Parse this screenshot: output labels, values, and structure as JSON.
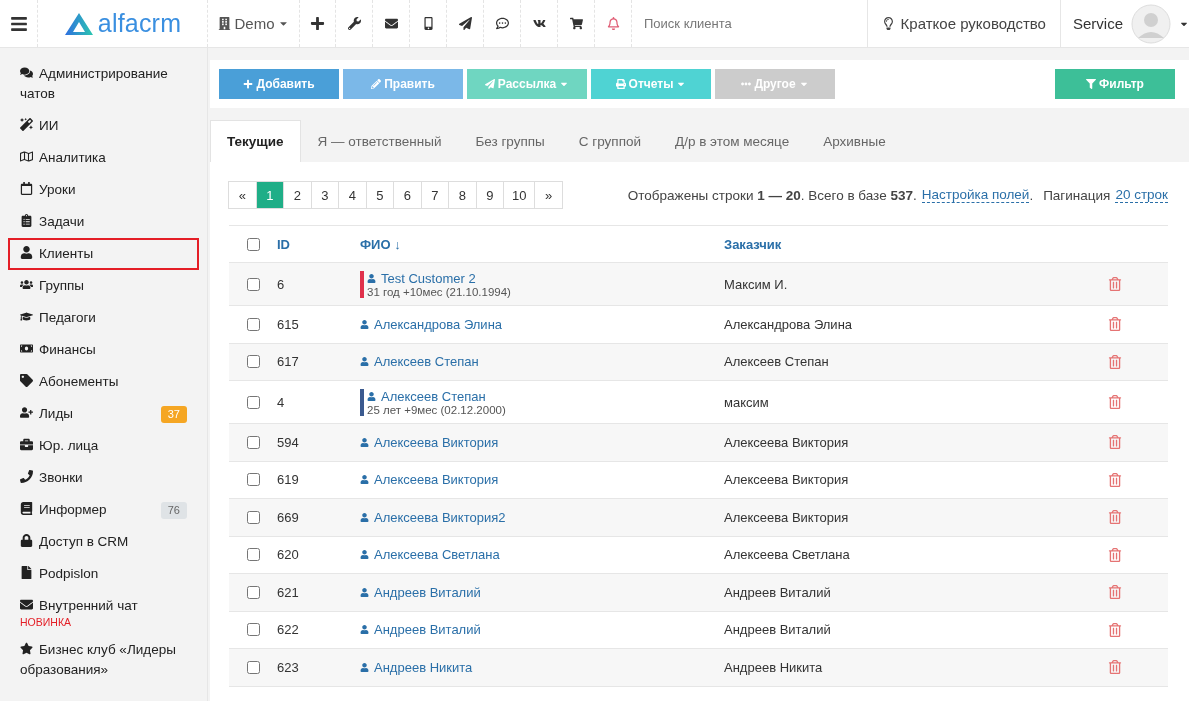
{
  "header": {
    "logo": "alfacrm",
    "branch": "Demo",
    "search": {
      "placeholder": "Поиск клиента"
    },
    "guide": "Краткое руководство",
    "user": "Service"
  },
  "sidebar": {
    "items": [
      {
        "label": "Администрирование чатов",
        "selected": false
      },
      {
        "label": "ИИ",
        "selected": false
      },
      {
        "label": "Аналитика",
        "selected": false
      },
      {
        "label": "Уроки",
        "selected": false
      },
      {
        "label": "Задачи",
        "selected": false
      },
      {
        "label": "Клиенты",
        "selected": true
      },
      {
        "label": "Группы",
        "selected": false
      },
      {
        "label": "Педагоги",
        "selected": false
      },
      {
        "label": "Финансы",
        "selected": false
      },
      {
        "label": "Абонементы",
        "selected": false
      },
      {
        "label": "Лиды",
        "selected": false,
        "badge": "37",
        "color": "#f5a623"
      },
      {
        "label": "Юр. лица",
        "selected": false
      },
      {
        "label": "Звонки",
        "selected": false
      },
      {
        "label": "Информер",
        "selected": false,
        "badge": "76",
        "color": "#dfe3e6"
      },
      {
        "label": "Доступ в CRM",
        "selected": false
      },
      {
        "label": "Podpislon",
        "selected": false
      },
      {
        "label": "Внутренний чат",
        "selected": false,
        "note": "НОВИНКА"
      },
      {
        "label": "Бизнес клуб «Лидеры образования»",
        "selected": false
      }
    ]
  },
  "toolbar": {
    "buttons": [
      {
        "label": "Добавить",
        "color": "#4a9fd8",
        "caret": false
      },
      {
        "label": "Править",
        "color": "#7bb8e8",
        "caret": false
      },
      {
        "label": "Рассылка",
        "color": "#6fd6c1",
        "caret": true
      },
      {
        "label": "Отчеты",
        "color": "#4fd3d3",
        "caret": true
      },
      {
        "label": "Другое",
        "color": "#cccccc",
        "caret": true
      }
    ],
    "filter": {
      "label": "Фильтр",
      "color": "#3dbf98"
    }
  },
  "tabs": [
    {
      "label": "Текущие",
      "selected": true
    },
    {
      "label": "Я — ответственный",
      "selected": false
    },
    {
      "label": "Без группы",
      "selected": false
    },
    {
      "label": "С группой",
      "selected": false
    },
    {
      "label": "Д/р в этом месяце",
      "selected": false
    },
    {
      "label": "Архивные",
      "selected": false
    }
  ],
  "pagination": {
    "pages": [
      {
        "label": "«",
        "selected": false
      },
      {
        "label": "1",
        "selected": true
      },
      {
        "label": "2",
        "selected": false
      },
      {
        "label": "3",
        "selected": false
      },
      {
        "label": "4",
        "selected": false
      },
      {
        "label": "5",
        "selected": false
      },
      {
        "label": "6",
        "selected": false
      },
      {
        "label": "7",
        "selected": false
      },
      {
        "label": "8",
        "selected": false
      },
      {
        "label": "9",
        "selected": false
      },
      {
        "label": "10",
        "selected": false
      },
      {
        "label": "»",
        "selected": false
      }
    ],
    "summary": "Отображены строки **1 — 20**. Всего в базе **537**.",
    "fields_link": "Настройка полей",
    "separator": ".",
    "per_page_label": "Пагинация",
    "per_page_link": "20 строк"
  },
  "table": {
    "select_all": {
      "checked": false
    },
    "columns": [
      "ID",
      "ФИО ↓",
      "Заказчик"
    ],
    "rows": [
      {
        "id": "6",
        "name": "Test Customer 2",
        "age": "31 год +10мес (21.10.1994)",
        "color": "#e0314b",
        "customer": "Максим И.",
        "checked": false
      },
      {
        "id": "615",
        "name": "Александрова Элина",
        "customer": "Александрова Элина",
        "checked": false
      },
      {
        "id": "617",
        "name": "Алексеев Степан",
        "customer": "Алексеев Степан",
        "checked": false
      },
      {
        "id": "4",
        "name": "Алексеев Степан",
        "age": "25 лет +9мес (02.12.2000)",
        "color": "#3b5a8f",
        "customer": "максим",
        "checked": false
      },
      {
        "id": "594",
        "name": "Алексеева Виктория",
        "customer": "Алексеева Виктория",
        "checked": false
      },
      {
        "id": "619",
        "name": "Алексеева Виктория",
        "customer": "Алексеева Виктория",
        "checked": false
      },
      {
        "id": "669",
        "name": "Алексеева Виктория2",
        "customer": "Алексеева Виктория",
        "checked": false
      },
      {
        "id": "620",
        "name": "Алексеева Светлана",
        "customer": "Алексеева Светлана",
        "checked": false
      },
      {
        "id": "621",
        "name": "Андреев Виталий",
        "customer": "Андреев Виталий",
        "checked": false
      },
      {
        "id": "622",
        "name": "Андреев Виталий",
        "customer": "Андреев Виталий",
        "checked": false
      },
      {
        "id": "623",
        "name": "Андреев Никита",
        "customer": "Андреев Никита",
        "checked": false
      }
    ]
  }
}
